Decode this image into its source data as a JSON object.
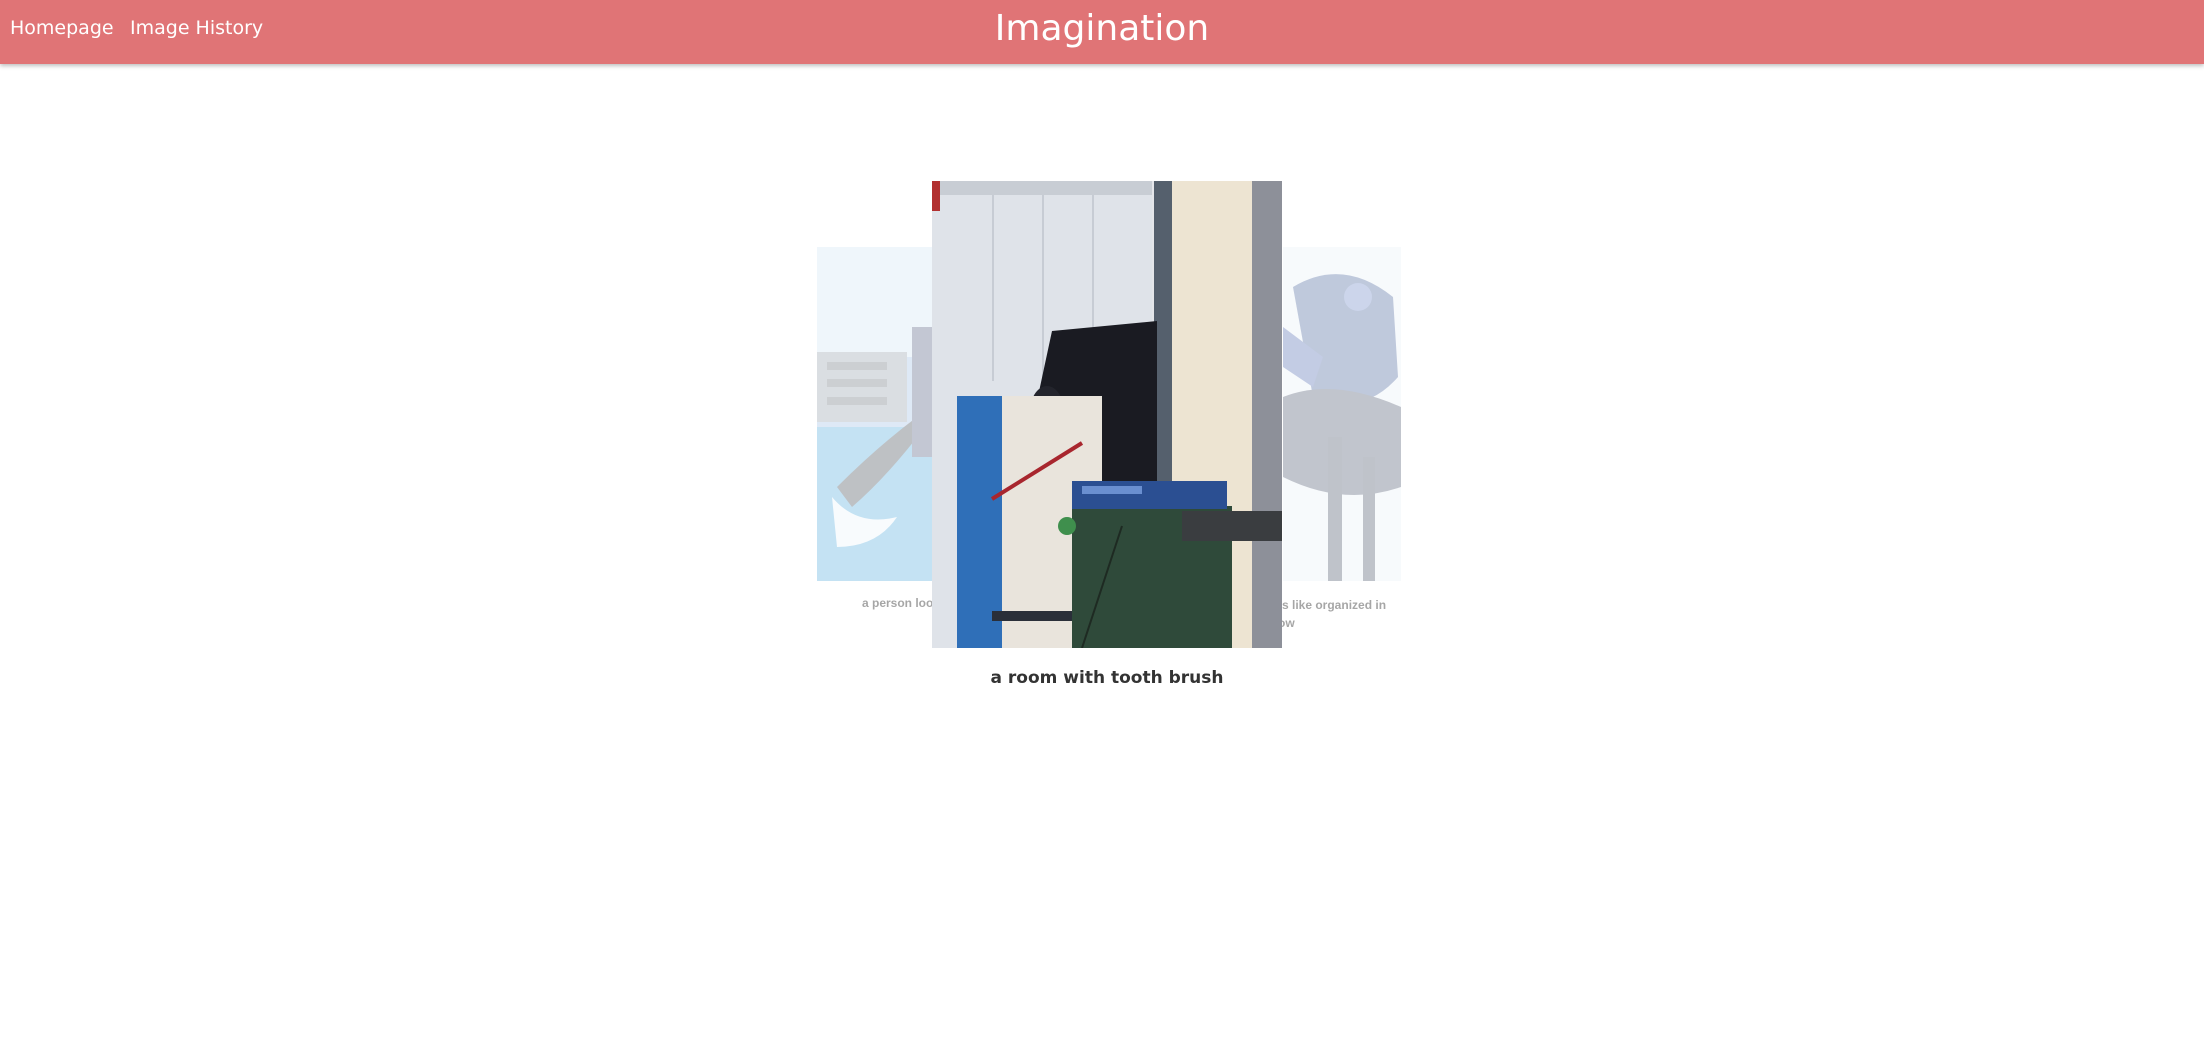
{
  "nav": {
    "home_label": "Homepage",
    "history_label": "Image History",
    "brand": "Imagination"
  },
  "carousel": {
    "prev": {
      "caption": "a person loo"
    },
    "current": {
      "caption": "a room with tooth brush"
    },
    "next": {
      "caption": "ts like organized in\now"
    }
  },
  "colors": {
    "navbar": "#e07476",
    "text_light": "#ffffff",
    "caption": "#333333"
  }
}
